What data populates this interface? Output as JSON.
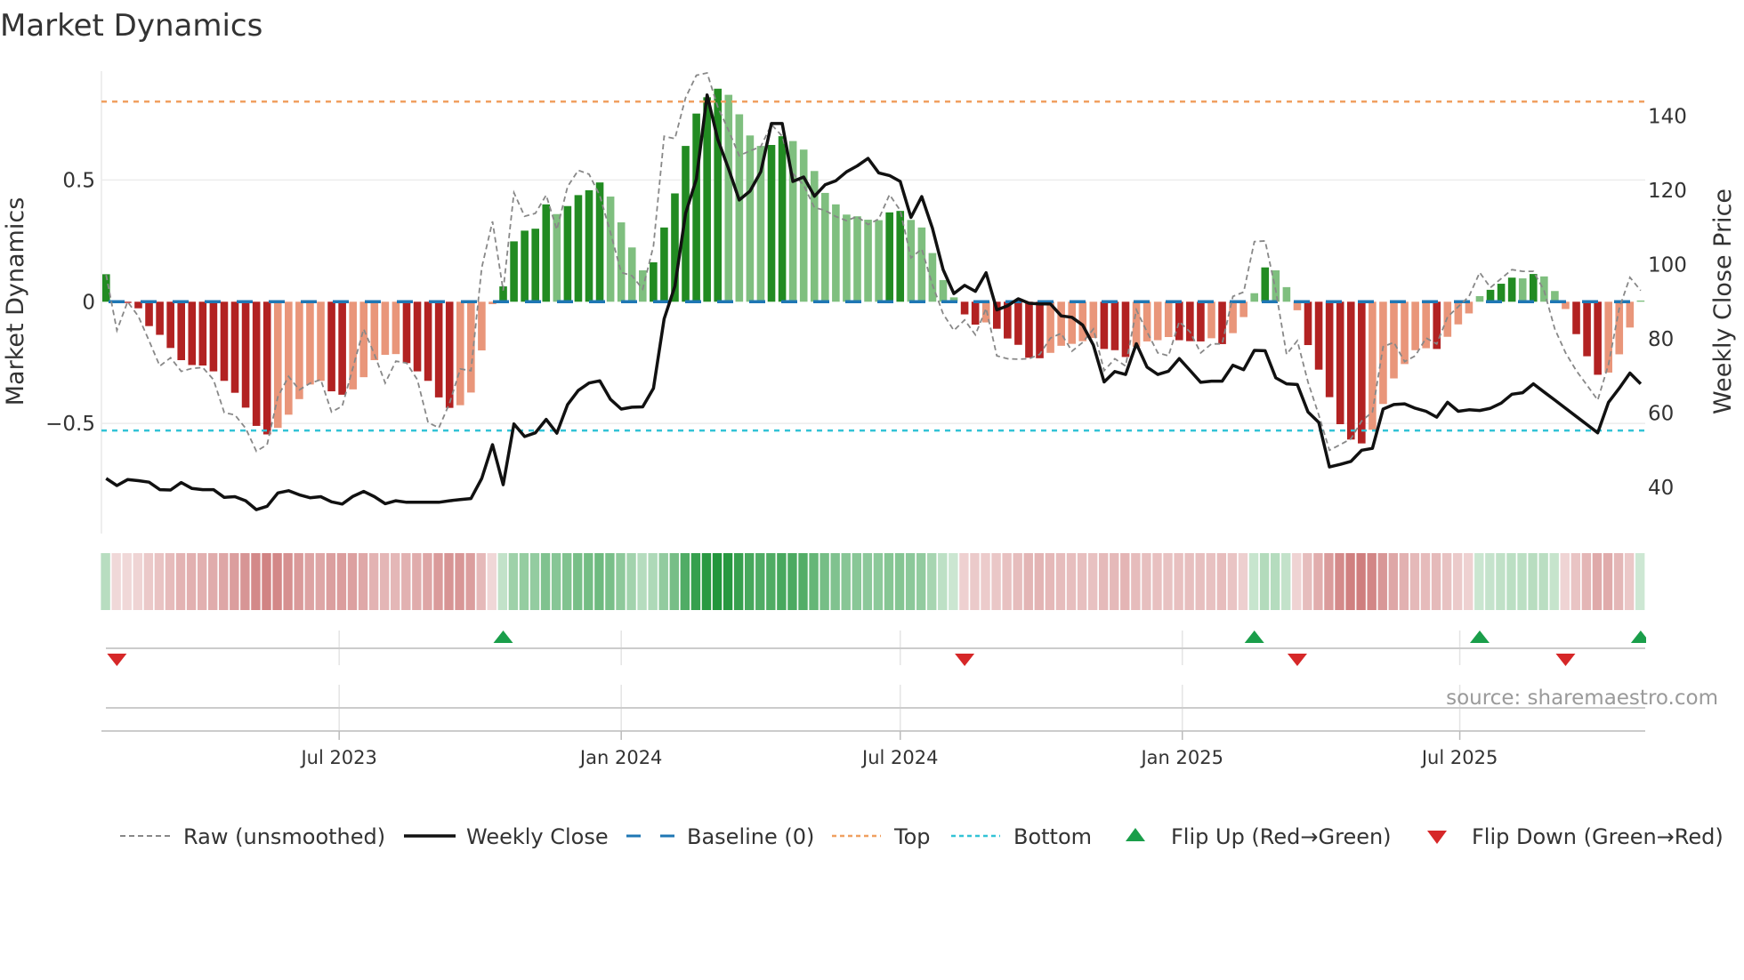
{
  "title": "Market Dynamics",
  "source_note": "source: sharemaestro.com",
  "colors": {
    "strong_negative": "#b22222",
    "weak_negative": "#e9967a",
    "strong_positive": "#228b22",
    "weak_positive": "#7fbf7f",
    "raw": "#888888",
    "close": "#111111",
    "baseline": "#1f77b4",
    "top": "#f0a060",
    "bottom": "#33c3d6",
    "flip_up": "#1a9e4a",
    "flip_down": "#d62728"
  },
  "legend": {
    "raw": "Raw (unsmoothed)",
    "close": "Weekly Close",
    "baseline": "Baseline (0)",
    "top": "Top",
    "bottom": "Bottom",
    "flip_up": "Flip Up (Red→Green)",
    "flip_down": "Flip Down (Green→Red)"
  },
  "chart_data": {
    "type": "bar",
    "title": "Market Dynamics",
    "ylabel": "Market Dynamics",
    "y2label": "Weekly Close Price",
    "ylim": [
      -0.76,
      0.95
    ],
    "y2lim": [
      27,
      148
    ],
    "x_start": "2023-01-30",
    "x_step_days": 7,
    "left_ticks": [
      {
        "value": 0.5,
        "label": "0.5"
      },
      {
        "value": 0,
        "label": "0"
      },
      {
        "value": -0.5,
        "label": "−0.5"
      }
    ],
    "right_ticks": [
      {
        "value": 140,
        "label": "140"
      },
      {
        "value": 120,
        "label": "120"
      },
      {
        "value": 100,
        "label": "100"
      },
      {
        "value": 80,
        "label": "80"
      },
      {
        "value": 60,
        "label": "60"
      },
      {
        "value": 40,
        "label": "40"
      }
    ],
    "x_ticks": [
      {
        "date": "2023-07-01",
        "label": "Jul 2023"
      },
      {
        "date": "2024-01-01",
        "label": "Jan 2024"
      },
      {
        "date": "2024-07-01",
        "label": "Jul 2024"
      },
      {
        "date": "2025-01-01",
        "label": "Jan 2025"
      },
      {
        "date": "2025-07-01",
        "label": "Jul 2025"
      }
    ],
    "top_level": 0.822,
    "bottom_level": -0.529,
    "baseline": 0,
    "series": [
      {
        "name": "Market Dynamics (smoothed)",
        "axis": "left",
        "values": [
          0.113,
          -0.004,
          -0.005,
          -0.027,
          -0.1,
          -0.136,
          -0.19,
          -0.24,
          -0.26,
          -0.262,
          -0.286,
          -0.325,
          -0.374,
          -0.435,
          -0.51,
          -0.545,
          -0.518,
          -0.464,
          -0.4,
          -0.34,
          -0.325,
          -0.368,
          -0.382,
          -0.36,
          -0.31,
          -0.24,
          -0.218,
          -0.215,
          -0.252,
          -0.286,
          -0.325,
          -0.393,
          -0.436,
          -0.425,
          -0.373,
          -0.2,
          -0.01,
          0.063,
          0.248,
          0.292,
          0.3,
          0.4,
          0.36,
          0.393,
          0.438,
          0.458,
          0.49,
          0.432,
          0.326,
          0.223,
          0.129,
          0.162,
          0.305,
          0.445,
          0.64,
          0.773,
          0.84,
          0.875,
          0.85,
          0.77,
          0.683,
          0.64,
          0.644,
          0.68,
          0.66,
          0.625,
          0.537,
          0.447,
          0.4,
          0.358,
          0.351,
          0.337,
          0.335,
          0.367,
          0.373,
          0.336,
          0.305,
          0.2,
          0.089,
          0.018,
          -0.052,
          -0.094,
          -0.085,
          -0.111,
          -0.151,
          -0.177,
          -0.23,
          -0.232,
          -0.21,
          -0.181,
          -0.173,
          -0.162,
          -0.149,
          -0.194,
          -0.199,
          -0.227,
          -0.185,
          -0.163,
          -0.158,
          -0.145,
          -0.158,
          -0.162,
          -0.163,
          -0.15,
          -0.174,
          -0.129,
          -0.063,
          0.035,
          0.141,
          0.129,
          0.06,
          -0.035,
          -0.178,
          -0.279,
          -0.392,
          -0.503,
          -0.566,
          -0.582,
          -0.526,
          -0.42,
          -0.315,
          -0.256,
          -0.199,
          -0.191,
          -0.194,
          -0.144,
          -0.093,
          -0.048,
          0.023,
          0.049,
          0.074,
          0.099,
          0.096,
          0.114,
          0.104,
          0.044,
          -0.03,
          -0.133,
          -0.224,
          -0.3,
          -0.291,
          -0.216,
          -0.106,
          0.005
        ]
      },
      {
        "name": "Raw (unsmoothed)",
        "axis": "left",
        "values": [
          0.11,
          -0.118,
          0,
          -0.06,
          -0.16,
          -0.264,
          -0.23,
          -0.286,
          -0.274,
          -0.27,
          -0.32,
          -0.455,
          -0.465,
          -0.52,
          -0.614,
          -0.587,
          -0.39,
          -0.307,
          -0.362,
          -0.335,
          -0.32,
          -0.453,
          -0.429,
          -0.27,
          -0.112,
          -0.216,
          -0.334,
          -0.244,
          -0.252,
          -0.32,
          -0.496,
          -0.518,
          -0.417,
          -0.276,
          -0.283,
          0.14,
          0.33,
          0.046,
          0.448,
          0.351,
          0.363,
          0.438,
          0.296,
          0.473,
          0.54,
          0.524,
          0.436,
          0.284,
          0.12,
          0.107,
          0.052,
          0.229,
          0.68,
          0.67,
          0.838,
          0.93,
          0.94,
          0.8,
          0.704,
          0.6,
          0.62,
          0.637,
          0.728,
          0.68,
          0.527,
          0.479,
          0.387,
          0.375,
          0.35,
          0.333,
          0.35,
          0.317,
          0.34,
          0.44,
          0.375,
          0.18,
          0.217,
          0.07,
          -0.05,
          -0.118,
          -0.075,
          -0.136,
          -0.027,
          -0.222,
          -0.234,
          -0.236,
          -0.234,
          -0.216,
          -0.149,
          -0.13,
          -0.203,
          -0.167,
          -0.112,
          -0.283,
          -0.234,
          -0.264,
          -0.033,
          -0.124,
          -0.21,
          -0.222,
          -0.082,
          -0.124,
          -0.21,
          -0.173,
          -0.173,
          0.022,
          0.04,
          0.247,
          0.25,
          0.046,
          -0.216,
          -0.16,
          -0.33,
          -0.465,
          -0.61,
          -0.587,
          -0.563,
          -0.49,
          -0.453,
          -0.185,
          -0.167,
          -0.246,
          -0.222,
          -0.149,
          -0.173,
          -0.063,
          -0.02,
          0.022,
          0.12,
          0.058,
          0.095,
          0.132,
          0.125,
          0.125,
          0.046,
          -0.112,
          -0.21,
          -0.283,
          -0.343,
          -0.404,
          -0.258,
          -0.027,
          0.1,
          0.046
        ]
      },
      {
        "name": "Weekly Close",
        "axis": "right",
        "values": [
          42.4,
          40.5,
          42.1,
          41.8,
          41.4,
          39.4,
          39.3,
          41.3,
          39.7,
          39.4,
          39.4,
          37.3,
          37.5,
          36.4,
          34.0,
          34.9,
          38.5,
          39.1,
          38.0,
          37.2,
          37.5,
          36.1,
          35.5,
          37.6,
          38.9,
          37.5,
          35.6,
          36.4,
          36.0,
          36.0,
          36.0,
          36.0,
          36.4,
          36.7,
          37.0,
          42.4,
          51.5,
          40.7,
          57.1,
          53.7,
          54.7,
          58.3,
          54.6,
          62.3,
          66.1,
          68.1,
          68.7,
          63.7,
          61.1,
          61.6,
          61.7,
          66.7,
          85.4,
          94.2,
          113.8,
          123.0,
          145.7,
          133.7,
          125.8,
          117.4,
          119.8,
          125.0,
          138.0,
          138.0,
          122.4,
          123.6,
          118.4,
          121.5,
          122.6,
          125.0,
          126.6,
          128.6,
          124.7,
          124.0,
          122.4,
          112.7,
          118.3,
          109.8,
          98.6,
          92.2,
          94.4,
          92.8,
          97.8,
          87.8,
          88.9,
          90.8,
          89.6,
          89.4,
          89.4,
          86.2,
          85.8,
          83.7,
          78.3,
          68.4,
          71.2,
          70.4,
          78.7,
          72.4,
          70.4,
          71.3,
          74.7,
          71.5,
          68.3,
          68.6,
          68.6,
          72.9,
          71.7,
          76.9,
          76.8,
          69.5,
          67.9,
          67.7,
          60.3,
          57.5,
          45.5,
          46.2,
          47.0,
          50.0,
          50.5,
          61.1,
          62.3,
          62.5,
          61.3,
          60.5,
          58.9,
          62.9,
          60.5,
          60.9,
          60.7,
          61.3,
          62.7,
          65.1,
          65.5,
          67.9,
          65.7,
          63.5,
          61.3,
          59.1,
          56.9,
          54.7,
          62.9,
          66.7,
          70.8,
          67.9
        ]
      }
    ],
    "flip_up_weeks": [
      38,
      108,
      129,
      144
    ],
    "flip_down_weeks": [
      2,
      81,
      112,
      137
    ],
    "legend_position": "bottom",
    "grid": true
  }
}
